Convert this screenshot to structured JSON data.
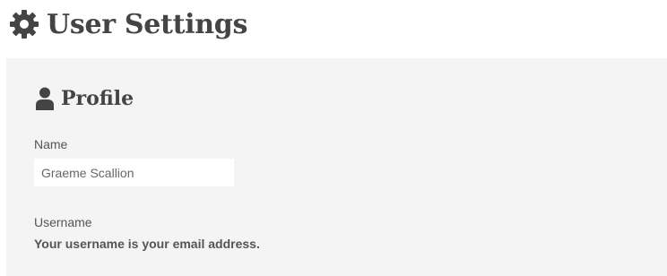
{
  "header": {
    "title": "User Settings",
    "icon": "gear-icon"
  },
  "profile": {
    "section_title": "Profile",
    "icon": "person-icon",
    "name_label": "Name",
    "name_value": "Graeme Scallion",
    "username_label": "Username",
    "username_note": "Your username is your email address."
  },
  "colors": {
    "text": "#444444",
    "panel_background": "#f4f4f4",
    "input_background": "#ffffff"
  }
}
